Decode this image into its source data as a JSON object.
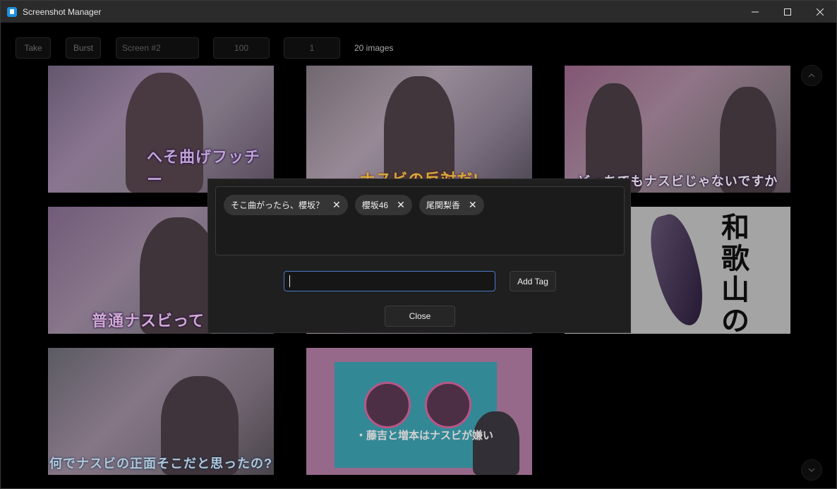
{
  "window": {
    "title": "Screenshot Manager"
  },
  "toolbar": {
    "take_label": "Take",
    "burst_label": "Burst",
    "screen_select": "Screen #2",
    "delay_value": "100",
    "count_value": "1",
    "image_count": "20 images"
  },
  "thumbnails": [
    {
      "caption": "へそ曲げフッチー"
    },
    {
      "caption": "ナスビの反対だ!"
    },
    {
      "caption": "どっちでもナスビじゃないですか"
    },
    {
      "caption": "普通ナスビって"
    },
    {
      "caption": "和歌山の"
    },
    {
      "caption": "何でナスビの正面そこだと思ったの?"
    },
    {
      "caption": "・藤吉と増本はナスビが嫌い"
    }
  ],
  "dialog": {
    "tags": [
      {
        "label": "そこ曲がったら、櫻坂？"
      },
      {
        "label": "櫻坂46"
      },
      {
        "label": "尾関梨香"
      }
    ],
    "input_value": "",
    "add_tag_label": "Add Tag",
    "close_label": "Close"
  },
  "colors": {
    "accent": "#4a78c8",
    "dialog_bg": "#1f1f1f",
    "chip_bg": "#353535"
  }
}
